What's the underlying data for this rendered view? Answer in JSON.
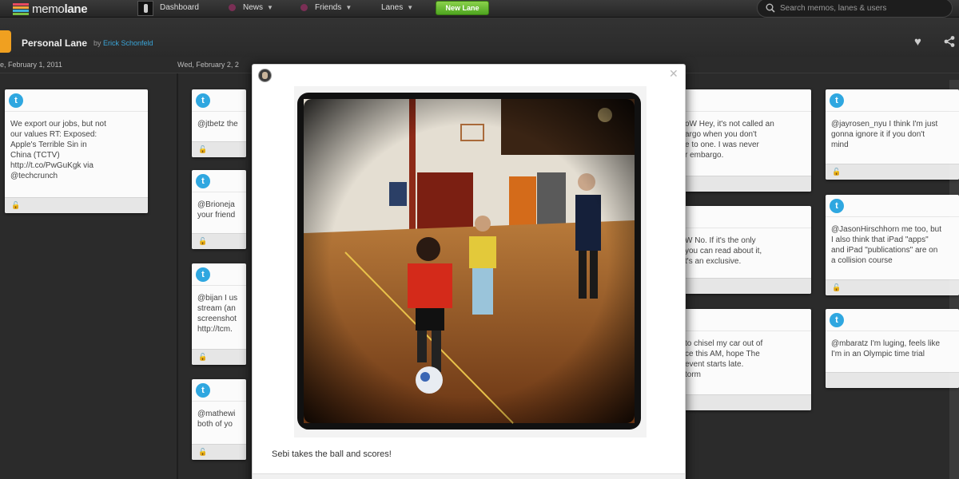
{
  "app": {
    "logo": {
      "text_regular": "memo",
      "text_bold": "lane",
      "stripe_colors": [
        "#e84a5f",
        "#f3a73b",
        "#3fb3dd",
        "#7bc043"
      ]
    }
  },
  "nav": {
    "dashboard": "Dashboard",
    "news": "News",
    "friends": "Friends",
    "lanes": "Lanes",
    "new_lane": "New Lane",
    "search_placeholder": "Search memos, lanes & users"
  },
  "lane": {
    "title": "Personal Lane",
    "by": "by",
    "author": "Erick Schonfeld"
  },
  "timeline": {
    "dates": [
      "e, February 1, 2011",
      "Wed, February 2, 2"
    ]
  },
  "cards": {
    "col1": [
      {
        "text": "We export our jobs, but not\nour values RT: Exposed:\nApple's Terrible Sin in\nChina (TCTV)\nhttp://t.co/PwGuKgk via\n@techcrunch"
      }
    ],
    "col2": [
      {
        "text": "@jtbetz the"
      },
      {
        "text": "@Brioneja\nyour friend"
      },
      {
        "text": "@bijan I us\nstream (an\nscreenshot\nhttp://tcm."
      },
      {
        "text": "@mathewi\nboth of yo"
      }
    ],
    "col3": [
      {
        "text": "oW Hey, it's not called an\nargo when you don't\ne to one. I was never\nr embargo."
      },
      {
        "text": "W No. If it's the only\nyou can read about it,\nt's an exclusive."
      },
      {
        "text": "to chisel my car out of\nce this AM, hope The\n event starts late.\ntorm"
      }
    ],
    "col4": [
      {
        "text": "@jayrosen_nyu I think I'm just\ngonna ignore it if you don't\nmind"
      },
      {
        "text": "@JasonHirschhorn me too, but\nI also think that iPad \"apps\"\nand iPad \"publications\" are on\na collision course"
      },
      {
        "text": "@mbaratz I'm luging, feels like\nI'm in an Olympic time trial"
      }
    ]
  },
  "modal": {
    "caption": "Sebi takes the ball and scores!",
    "close_icon": "close-icon"
  },
  "colors": {
    "accent_green": "#5cb82a",
    "twitter_blue": "#2fa7e0",
    "author_link": "#3aa5d8",
    "lane_tab": "#f0a020"
  }
}
